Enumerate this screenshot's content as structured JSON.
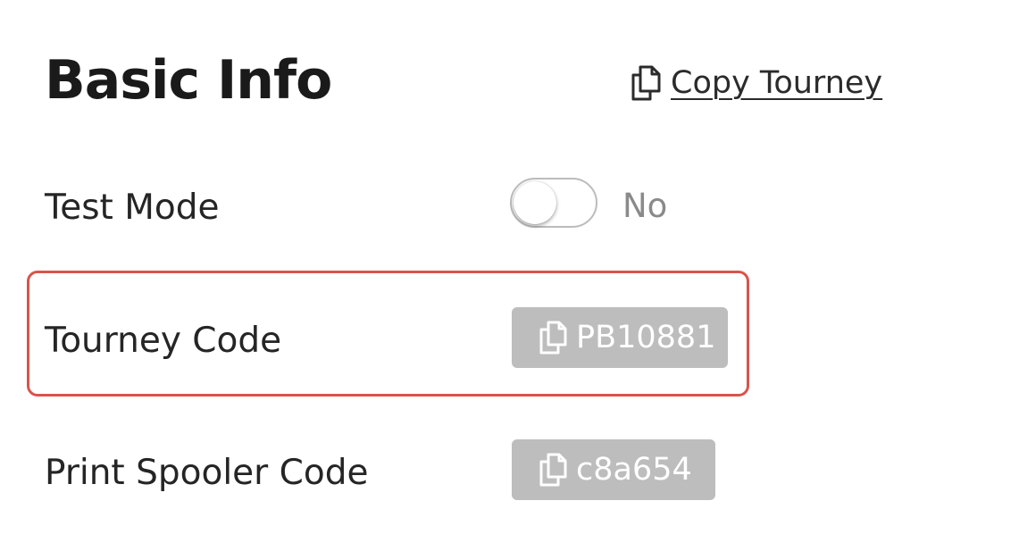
{
  "section": {
    "title": "Basic Info",
    "copy_link": {
      "icon": "copy-icon",
      "label": "Copy Tourney"
    }
  },
  "rows": {
    "test_mode": {
      "label": "Test Mode",
      "toggle_on": false,
      "state_text": "No"
    },
    "tourney_code": {
      "label": "Tourney Code",
      "icon": "copy-icon",
      "value": "PB10881",
      "highlighted": true
    },
    "print_spooler_code": {
      "label": "Print Spooler Code",
      "icon": "copy-icon",
      "value": "c8a654"
    }
  },
  "colors": {
    "highlight_border": "#d9544a",
    "code_pill_bg": "#bdbdbd",
    "toggle_border": "#bcbcbc",
    "muted_text": "#8a8a8a"
  }
}
